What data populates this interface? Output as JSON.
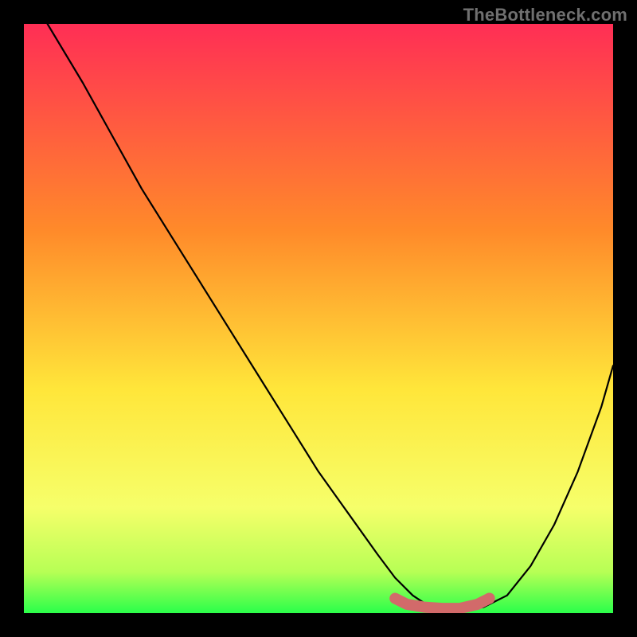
{
  "watermark": "TheBottleneck.com",
  "colors": {
    "background": "#000000",
    "gradient_top": "#ff2e55",
    "gradient_mid1": "#ff8a2a",
    "gradient_mid2": "#ffe63a",
    "gradient_mid3": "#f6ff6a",
    "gradient_bottom": "#2aff4a",
    "curve_stroke": "#000000",
    "marker_stroke": "#d26a6a",
    "marker_fill": "#d26a6a",
    "watermark_text": "#6f6f6f"
  },
  "chart_data": {
    "type": "line",
    "title": "",
    "xlabel": "",
    "ylabel": "",
    "xlim": [
      0,
      100
    ],
    "ylim": [
      0,
      100
    ],
    "series": [
      {
        "name": "bottleneck-curve",
        "x": [
          4,
          10,
          15,
          20,
          25,
          30,
          35,
          40,
          45,
          50,
          55,
          60,
          63,
          66,
          69,
          72,
          75,
          78,
          82,
          86,
          90,
          94,
          98,
          100
        ],
        "y": [
          100,
          90,
          81,
          72,
          64,
          56,
          48,
          40,
          32,
          24,
          17,
          10,
          6,
          3,
          1,
          0.5,
          0.5,
          1,
          3,
          8,
          15,
          24,
          35,
          42
        ]
      }
    ],
    "markers": {
      "name": "flat-minimum-highlight",
      "points": [
        {
          "x": 63,
          "y": 2.5
        },
        {
          "x": 65,
          "y": 1.5
        },
        {
          "x": 68,
          "y": 1.0
        },
        {
          "x": 71,
          "y": 0.8
        },
        {
          "x": 74,
          "y": 0.8
        },
        {
          "x": 77,
          "y": 1.5
        },
        {
          "x": 79,
          "y": 2.5
        }
      ]
    },
    "gradient_stops": [
      {
        "offset": 0.0,
        "color": "#ff2e55"
      },
      {
        "offset": 0.35,
        "color": "#ff8a2a"
      },
      {
        "offset": 0.62,
        "color": "#ffe63a"
      },
      {
        "offset": 0.82,
        "color": "#f6ff6a"
      },
      {
        "offset": 0.93,
        "color": "#b7ff55"
      },
      {
        "offset": 1.0,
        "color": "#2aff4a"
      }
    ]
  }
}
